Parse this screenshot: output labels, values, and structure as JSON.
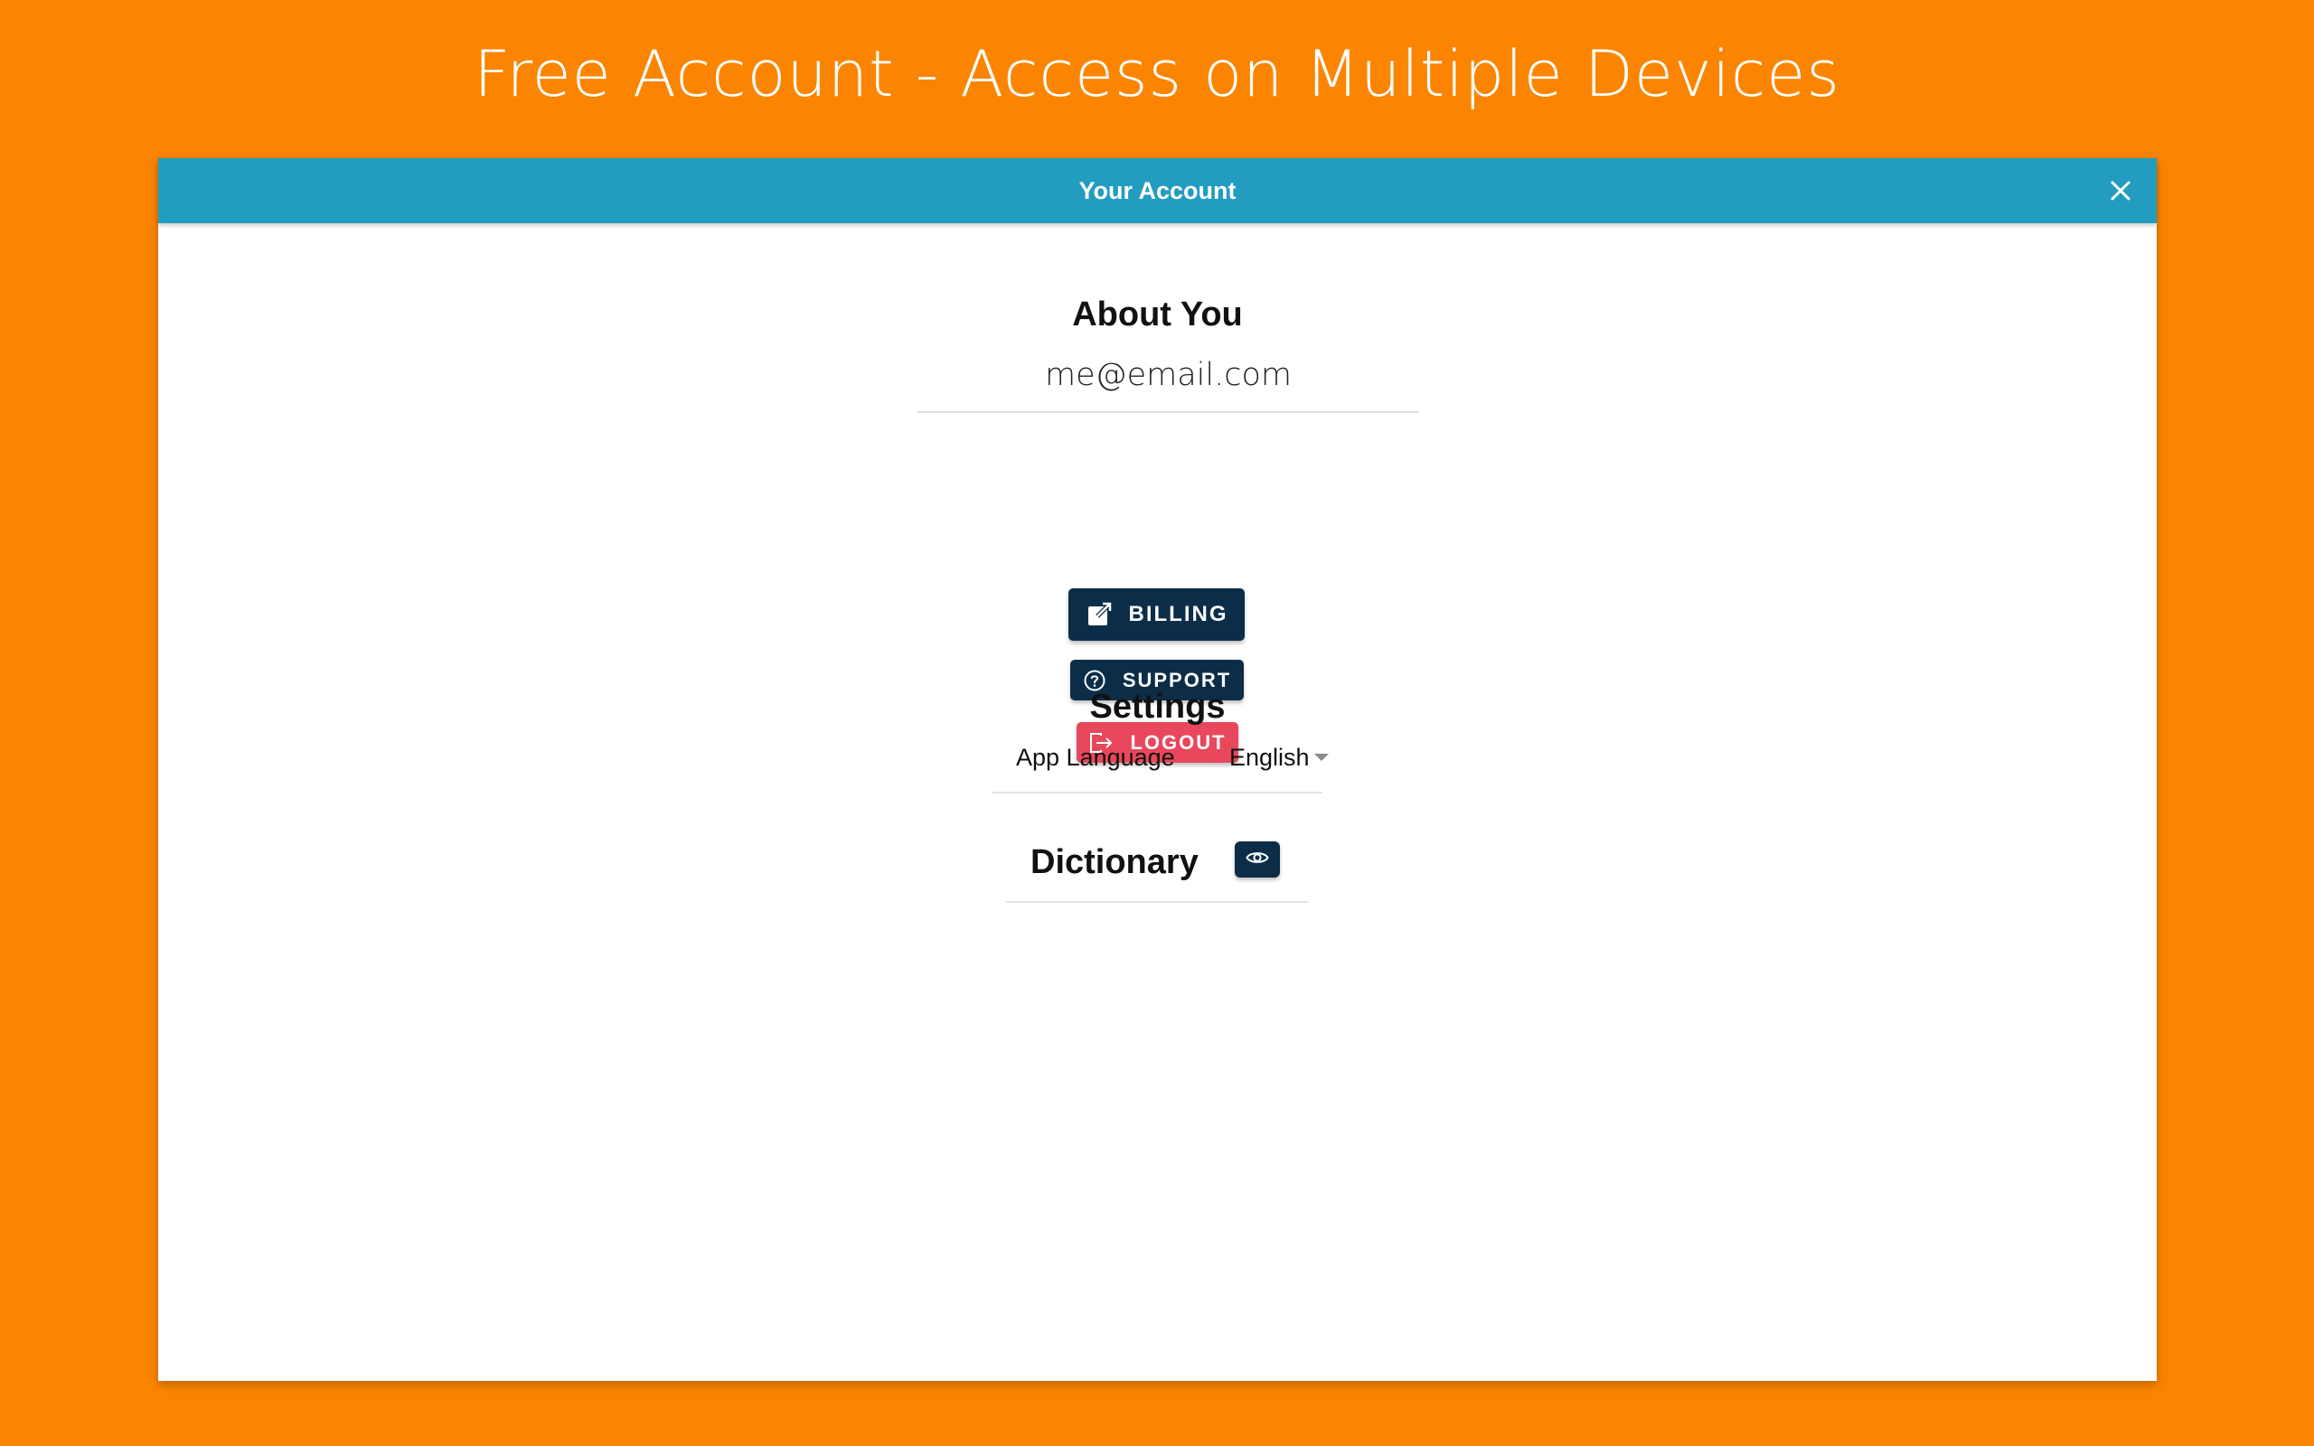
{
  "promo": {
    "headline": "Free Account - Access on Multiple Devices",
    "background_color": "#FB8500"
  },
  "window": {
    "title": "Your Account",
    "titlebar_color": "#239DBF",
    "close_icon": "close-icon"
  },
  "about": {
    "heading": "About You",
    "email": "me@email.com"
  },
  "buttons": {
    "billing": {
      "label": "BILLING",
      "icon": "external-link-icon",
      "color": "#0C2D48"
    },
    "support": {
      "label": "SUPPORT",
      "icon": "help-circle-icon",
      "color": "#0C2D48"
    },
    "logout": {
      "label": "LOGOUT",
      "icon": "logout-icon",
      "color": "#E8475C"
    }
  },
  "settings": {
    "heading": "Settings",
    "app_language_label": "App Language",
    "app_language_value": "English"
  },
  "dictionary": {
    "heading": "Dictionary",
    "toggle_icon": "eye-icon",
    "toggle_color": "#0C2D48"
  }
}
